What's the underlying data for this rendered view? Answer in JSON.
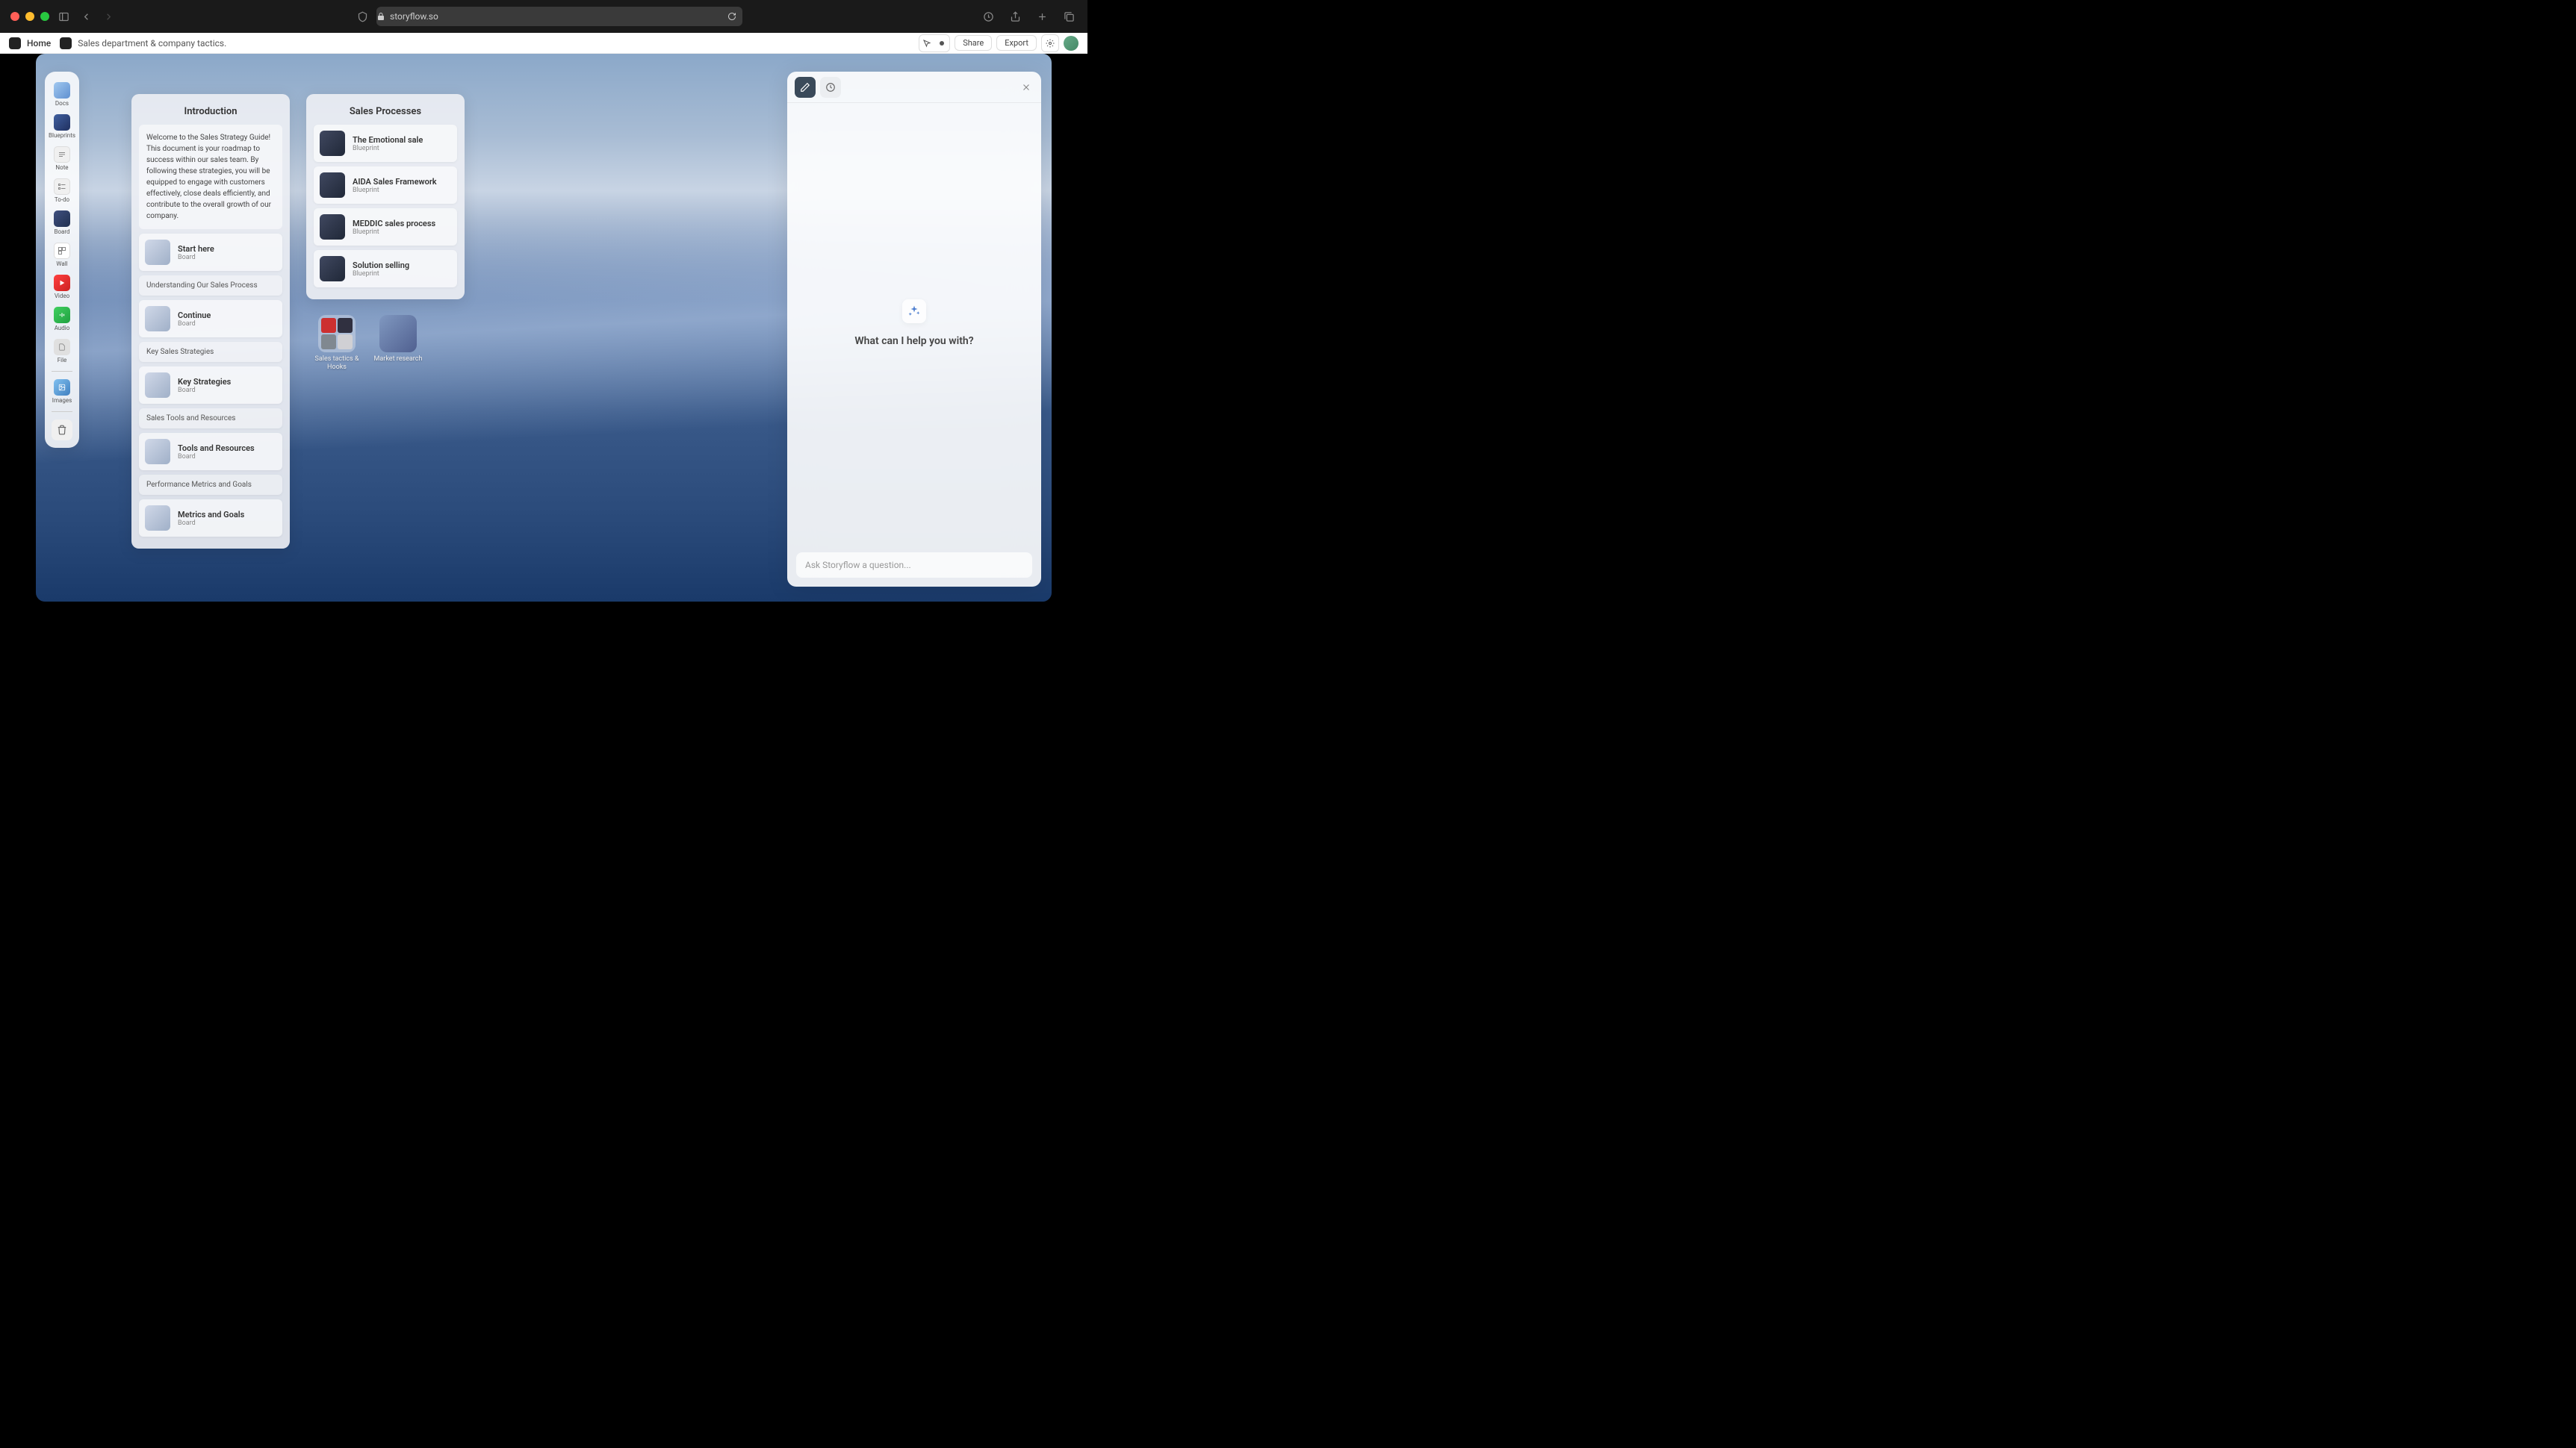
{
  "browser": {
    "url": "storyflow.so"
  },
  "header": {
    "home": "Home",
    "breadcrumb": "Sales department & company tactics.",
    "share": "Share",
    "export": "Export"
  },
  "sidebar": {
    "items": [
      {
        "label": "Docs"
      },
      {
        "label": "Blueprints"
      },
      {
        "label": "Note"
      },
      {
        "label": "To-do"
      },
      {
        "label": "Board"
      },
      {
        "label": "Wall"
      },
      {
        "label": "Video"
      },
      {
        "label": "Audio"
      },
      {
        "label": "File"
      }
    ],
    "images": "Images"
  },
  "cards": {
    "introduction": {
      "title": "Introduction",
      "text": "Welcome to the Sales Strategy Guide! This document is your roadmap to success within our sales team. By following these strategies, you will be equipped to engage with customers effectively, close deals efficiently, and contribute to the overall growth of our company.",
      "items": [
        {
          "title": "Start here",
          "sub": "Board",
          "type": "board"
        },
        {
          "title": "Understanding Our Sales Process",
          "type": "heading"
        },
        {
          "title": "Continue",
          "sub": "Board",
          "type": "board"
        },
        {
          "title": "Key Sales Strategies",
          "type": "heading"
        },
        {
          "title": "Key Strategies",
          "sub": "Board",
          "type": "board"
        },
        {
          "title": "Sales Tools and Resources",
          "type": "heading"
        },
        {
          "title": "Tools and Resources",
          "sub": "Board",
          "type": "board"
        },
        {
          "title": "Performance Metrics and Goals",
          "type": "heading"
        },
        {
          "title": "Metrics and Goals",
          "sub": "Board",
          "type": "board"
        }
      ]
    },
    "processes": {
      "title": "Sales Processes",
      "items": [
        {
          "title": "The Emotional sale",
          "sub": "Blueprint"
        },
        {
          "title": "AIDA Sales Framework",
          "sub": "Blueprint"
        },
        {
          "title": "MEDDIC sales process",
          "sub": "Blueprint"
        },
        {
          "title": "Solution selling",
          "sub": "Blueprint"
        }
      ]
    }
  },
  "folders": [
    {
      "label": "Sales tactics & Hooks"
    },
    {
      "label": "Market research"
    }
  ],
  "ai": {
    "prompt": "What can I help you with?",
    "placeholder": "Ask Storyflow a question..."
  }
}
